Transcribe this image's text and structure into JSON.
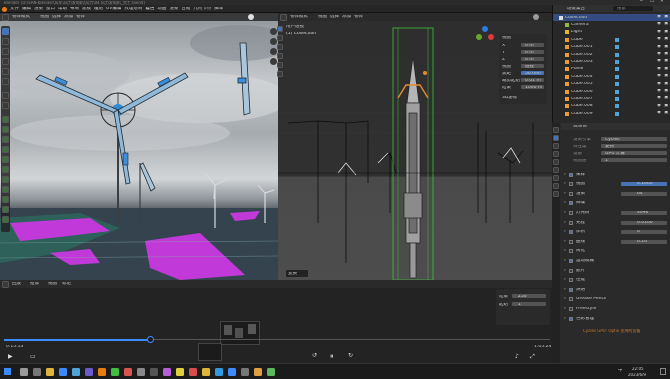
{
  "window": {
    "title": "Blender [D:\\SAN-blender\\风车\\风力发电机\\风力\\04 风力发电机_完工.blend]"
  },
  "menubar": {
    "items": [
      "文件",
      "编辑",
      "渲染",
      "窗口",
      "帮助",
      "布局",
      "建模",
      "雕刻",
      "UV编辑",
      "纹理绘制",
      "着色",
      "动画",
      "渲染",
      "合成",
      "几何节点",
      "脚本"
    ],
    "scene_label": "Scene",
    "view_layer_label": "ViewLayer"
  },
  "left_viewport": {
    "header_mode": "物体模式",
    "header_menus": [
      "视图",
      "选择",
      "添加",
      "物体"
    ]
  },
  "right_viewport": {
    "header_mode": "物体模式",
    "header_menus": [
      "视图",
      "选择",
      "添加",
      "物体"
    ],
    "overlay_line1": "用户透视",
    "overlay_line2": "(1) Collection",
    "status_tag": "变换"
  },
  "n_panel": {
    "rows": [
      {
        "label": "X",
        "value": "0 m"
      },
      {
        "label": "Y",
        "value": "0 m"
      },
      {
        "label": "Z",
        "value": "0 m"
      },
      {
        "label": "视图",
        "value": "透视"
      },
      {
        "label": "焦距",
        "value": "50 mm"
      },
      {
        "label": "裁剪起始",
        "value": "0.01 m"
      },
      {
        "label": "结束",
        "value": "1000 m"
      }
    ],
    "section_labels": [
      "视图",
      "3D游标"
    ]
  },
  "outliner": {
    "header_label": "场景集合",
    "search_placeholder": "搜索",
    "items": [
      "Collection",
      "Camera",
      "Light",
      "Cube",
      "Cube.001",
      "Cube.002",
      "Cube.003",
      "Plane",
      "Cube.004",
      "Cube.005",
      "Cube.006",
      "Cube.007",
      "Cube.008",
      "Cube.009"
    ]
  },
  "properties": {
    "object_name": "Scene",
    "rows": [
      {
        "label": "渲染引擎",
        "value": "Cycles"
      },
      {
        "label": "特性集",
        "value": "支持"
      },
      {
        "label": "设备",
        "value": "GPU 计算"
      },
      {
        "label": "视图层",
        "value": "1"
      }
    ],
    "sections": [
      "采样",
      "视图",
      "渲染",
      "降噪",
      "灯光树",
      "光程",
      "体积",
      "曲线",
      "简化",
      "运动模糊",
      "胶片",
      "性能",
      "烘焙",
      "Grease Pencil",
      "Freestyle",
      "色彩管理"
    ],
    "values": [
      "0.1000",
      "64",
      "4096",
      "0.0100",
      "0",
      "0.10"
    ],
    "warning": "Cycles GPU: Optix 支持的设备"
  },
  "timeline": {
    "header_items": [
      "回放",
      "抠像",
      "视图",
      "标记"
    ],
    "current_time": "0:15:13",
    "total_time": "1:05:24",
    "mini_panel_labels": [
      "结束",
      "起始"
    ],
    "mini_panel_values": [
      "250",
      "1"
    ]
  },
  "taskbar": {
    "clock_time": "22:05",
    "clock_date": "2023/6/9",
    "lang": "中"
  },
  "colors": {
    "accent_blue": "#3b8bff",
    "select_orange": "#e5892f",
    "active_green": "#3fbf3f",
    "magenta_ground": "#c239d9"
  }
}
